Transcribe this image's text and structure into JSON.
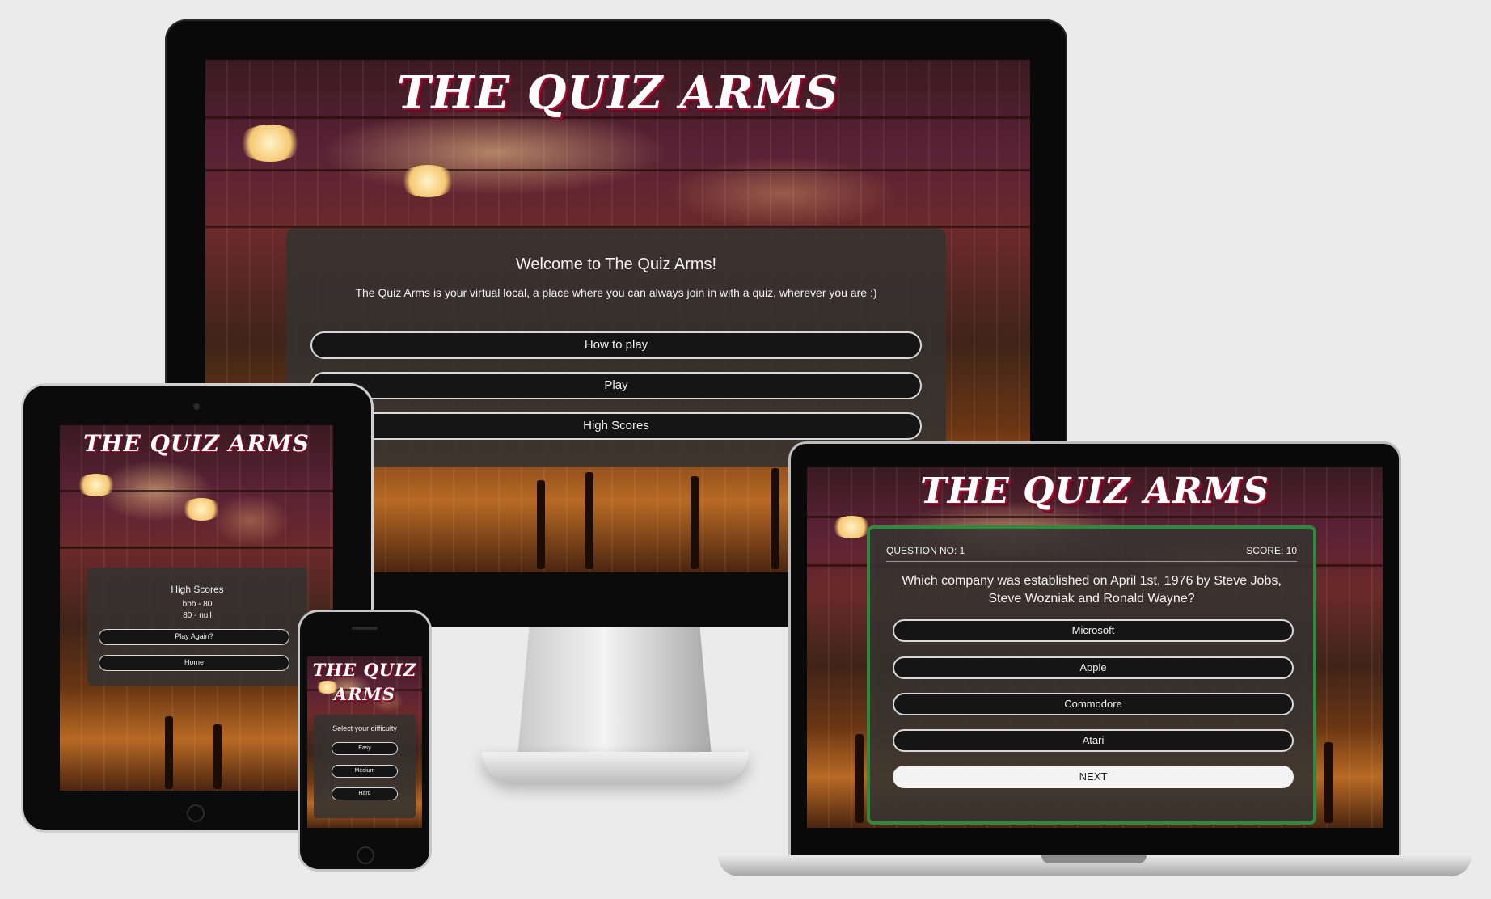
{
  "brand": {
    "title": "THE QUIZ ARMS",
    "title_line1": "THE QUIZ",
    "title_line2": "ARMS"
  },
  "colors": {
    "accent_red": "#9c1131",
    "panel": "#343230",
    "pill": "#151515",
    "correct_green": "#2e8b3d"
  },
  "desktop": {
    "welcome_title": "Welcome to The Quiz Arms!",
    "welcome_text": "The Quiz Arms is your virtual local, a place where you can always join in with a quiz, wherever you are :)",
    "buttons": [
      {
        "label": "How to play"
      },
      {
        "label": "Play"
      },
      {
        "label": "High Scores"
      }
    ]
  },
  "tablet": {
    "heading": "High Scores",
    "scores": [
      "bbb - 80",
      "80 - null"
    ],
    "buttons": [
      {
        "label": "Play Again?"
      },
      {
        "label": "Home"
      }
    ]
  },
  "phone": {
    "prompt": "Select your difficulty",
    "buttons": [
      {
        "label": "Easy"
      },
      {
        "label": "Medium"
      },
      {
        "label": "Hard"
      }
    ]
  },
  "laptop": {
    "question_no": "QUESTION NO: 1",
    "score": "SCORE: 10",
    "question": "Which company was established on April 1st, 1976 by Steve Jobs, Steve Wozniak and Ronald Wayne?",
    "answers": [
      {
        "label": "Microsoft"
      },
      {
        "label": "Apple"
      },
      {
        "label": "Commodore"
      },
      {
        "label": "Atari"
      }
    ],
    "next_label": "NEXT"
  }
}
